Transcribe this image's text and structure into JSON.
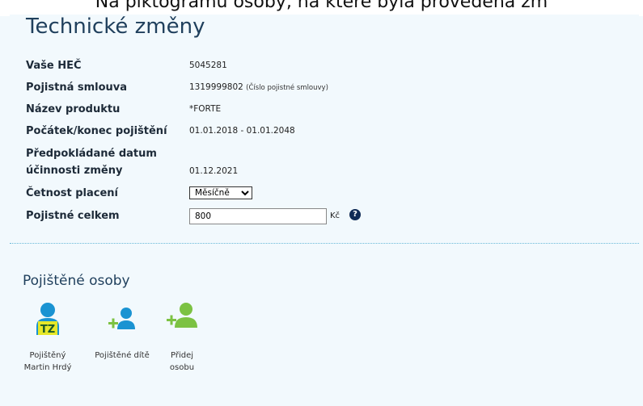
{
  "caption": "Na piktogramu osoby, na které byla provedena zm",
  "page_title": "Technické změny",
  "fields": [
    {
      "label": "Vaše HEČ",
      "value": "5045281"
    },
    {
      "label": "Pojistná smlouva",
      "value": "1319999802",
      "note": "(Číslo pojistné smlouvy)"
    },
    {
      "label": "Název produktu",
      "value": "*FORTE"
    },
    {
      "label": "Počátek/konec pojištění",
      "value": "01.01.2018 - 01.01.2048"
    },
    {
      "label_line1": "Předpokládané datum",
      "label_line2": "účinnosti změny",
      "value": "01.12.2021"
    }
  ],
  "payment_frequency": {
    "label": "Četnost placení",
    "selected": "Měsíčně"
  },
  "premium": {
    "label": "Pojistné celkem",
    "value": "800",
    "unit": "Kč",
    "help": "?"
  },
  "insured_section": {
    "title": "Pojištěné osoby",
    "persons": [
      {
        "line1": "Pojištěný",
        "line2": "Martin Hrdý",
        "badge": "TZ"
      },
      {
        "line1": "Pojištěné dítě",
        "line2": ""
      },
      {
        "line1": "Přidej",
        "line2": "osobu"
      }
    ]
  },
  "colors": {
    "background": "#f2f9fd",
    "title": "#1f3f5c",
    "person_blue": "#1a93d2",
    "add_green": "#7cc242",
    "badge_yellow": "#e6e829"
  }
}
